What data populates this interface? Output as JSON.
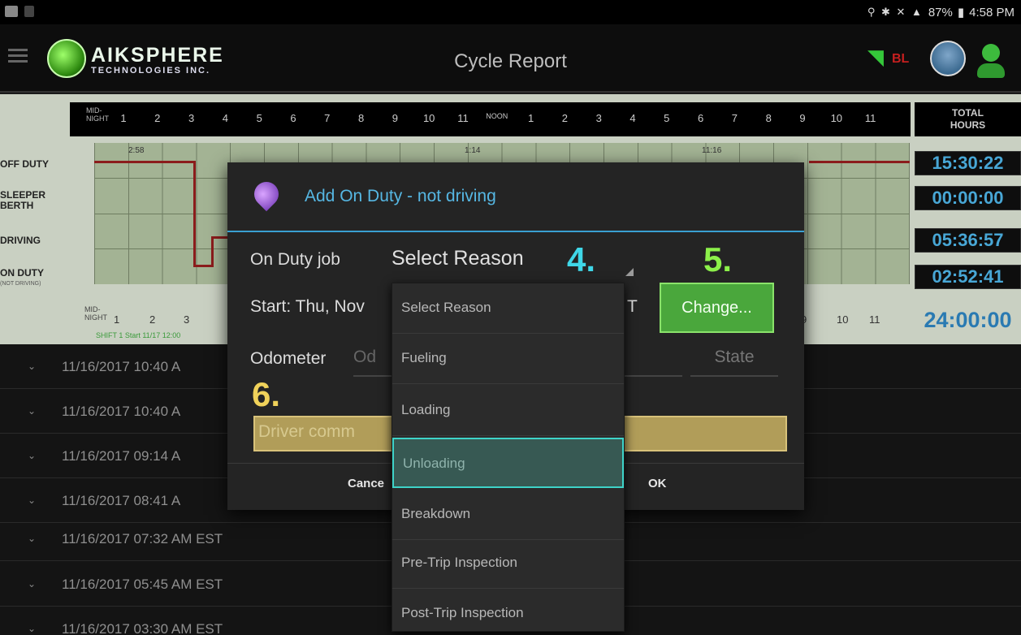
{
  "status_bar": {
    "battery": "87%",
    "time": "4:58 PM"
  },
  "app_bar": {
    "logo_name": "AIKSPHERE",
    "logo_sub": "TECHNOLOGIES INC.",
    "title": "Cycle Report",
    "connection_label": "BL",
    "icons": [
      "menu-icon",
      "wifi-icon",
      "cloud-sync-icon",
      "driver-icon"
    ]
  },
  "log_grid": {
    "hours_header": [
      "1",
      "2",
      "3",
      "4",
      "5",
      "6",
      "7",
      "8",
      "9",
      "10",
      "11",
      "NOON",
      "1",
      "2",
      "3",
      "4",
      "5",
      "6",
      "7",
      "8",
      "9",
      "10",
      "11"
    ],
    "midnight_label": "MID-\nNIGHT",
    "total_hours_label": "TOTAL\nHOURS",
    "rows": [
      {
        "label": "OFF DUTY",
        "sub": "",
        "total": "15:30:22"
      },
      {
        "label": "SLEEPER BERTH",
        "sub": "",
        "total": "00:00:00"
      },
      {
        "label": "DRIVING",
        "sub": "",
        "total": "05:36:57"
      },
      {
        "label": "ON DUTY",
        "sub": "(NOT DRIVING)",
        "total": "02:52:41"
      }
    ],
    "grand_total": "24:00:00",
    "time_tags": [
      "2:58",
      "1:14",
      "11:16"
    ],
    "footer_hours": [
      "1",
      "2",
      "3",
      "10",
      "11"
    ],
    "footer_hours_right": "9",
    "shift_label": "SHIFT 1 Start 11/17 12:00"
  },
  "events": [
    "11/16/2017 10:40 A",
    "11/16/2017 10:40 A",
    "11/16/2017 09:14 A",
    "11/16/2017 08:41 A",
    "11/16/2017 07:32 AM EST",
    "11/16/2017 05:45 AM EST",
    "11/16/2017 03:30 AM EST"
  ],
  "dialog": {
    "title": "Add On Duty - not driving",
    "on_duty_job_label": "On Duty job",
    "selected_reason": "Select Reason",
    "start_label": "Start: Thu, Nov",
    "start_tail": "T",
    "change_button": "Change...",
    "odometer_label": "Odometer",
    "odometer_placeholder": "Od",
    "state_placeholder": "State",
    "comment_placeholder": "Driver comm",
    "cancel_button": "Cance",
    "ok_button": "OK",
    "annotations": [
      "4.",
      "5.",
      "6."
    ],
    "annotation_colors": {
      "n4": "#3fd7e8",
      "n5": "#8cf04a",
      "n6": "#f0d25a"
    }
  },
  "dropdown": {
    "options": [
      "Select Reason",
      "Fueling",
      "Loading",
      "Unloading",
      "Breakdown",
      "Pre-Trip Inspection",
      "Post-Trip Inspection"
    ],
    "highlighted_index": 3
  },
  "colors": {
    "accent_blue": "#56b7e3",
    "change_green": "#4aa73c",
    "duty_line": "#8b1c1c",
    "total_blue": "#48a7d6"
  }
}
